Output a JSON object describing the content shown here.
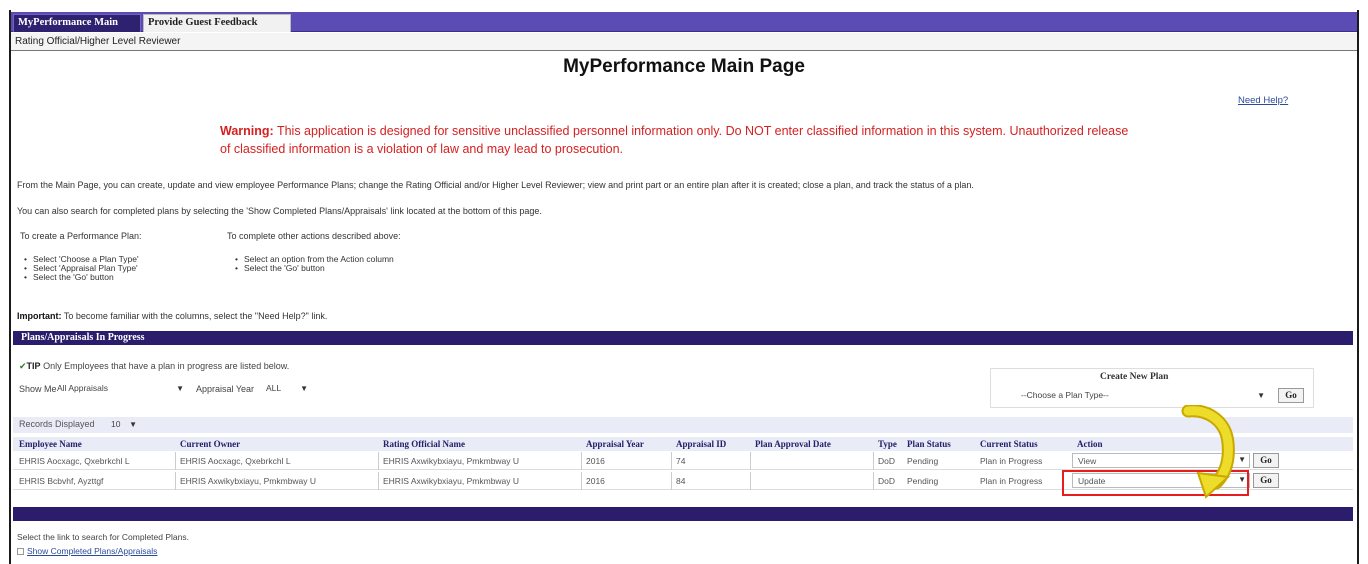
{
  "tabs": {
    "main": "MyPerformance Main Page",
    "feedback": "Provide Guest Feedback"
  },
  "role": "Rating Official/Higher Level Reviewer",
  "page_title": "MyPerformance Main Page",
  "help_link": "Need Help?",
  "warning": {
    "label": "Warning:",
    "text": "This application is designed for sensitive unclassified personnel information only. Do NOT enter classified information in this system. Unauthorized release of classified information is a violation of law and may lead to prosecution."
  },
  "intro": {
    "line1": "From the Main Page, you can create, update and view employee Performance Plans; change the Rating Official and/or Higher Level Reviewer; view and print part or an entire plan after it is created; close a plan, and track the status of a plan.",
    "line2": "You can also search for completed plans by selecting the 'Show Completed Plans/Appraisals' link located at the bottom of this page."
  },
  "create_instructions": {
    "heading": "To create a Performance Plan:",
    "steps": [
      "Select 'Choose a Plan Type'",
      "Select 'Appraisal Plan Type'",
      "Select the 'Go' button"
    ]
  },
  "other_instructions": {
    "heading": "To complete other actions described above:",
    "steps": [
      "Select an option from the Action column",
      "Select the 'Go' button"
    ]
  },
  "important": {
    "label": "Important:",
    "text": "To become familiar with the columns, select the \"Need Help?\" link."
  },
  "section_title": "Plans/Appraisals In Progress",
  "tip": {
    "label": "TIP",
    "text": "Only Employees that have a plan in progress are listed below."
  },
  "filters": {
    "show_me_label": "Show Me",
    "show_me_value": "All Appraisals",
    "year_label": "Appraisal Year",
    "year_value": "ALL"
  },
  "create_plan": {
    "title": "Create New Plan",
    "placeholder": "--Choose a Plan Type--",
    "go": "Go"
  },
  "records": {
    "label": "Records Displayed",
    "value": "10"
  },
  "table": {
    "headers": [
      "Employee Name",
      "Current Owner",
      "Rating Official Name",
      "Appraisal Year",
      "Appraisal ID",
      "Plan Approval Date",
      "Type",
      "Plan Status",
      "Current Status",
      "Action"
    ],
    "rows": [
      {
        "employee": "EHRIS Aocxagc, Qxebrkchl L",
        "owner": "EHRIS Aocxagc, Qxebrkchl L",
        "rating_official": "EHRIS Axwikybxiayu, Pmkmbway U",
        "year": "2016",
        "id": "74",
        "approval_date": "",
        "type": "DoD",
        "plan_status": "Pending",
        "current_status": "Plan in Progress",
        "action": "View",
        "go": "Go"
      },
      {
        "employee": "EHRIS Bcbvhf, Ayzttgf",
        "owner": "EHRIS Axwikybxiayu, Pmkmbway U",
        "rating_official": "EHRIS Axwikybxiayu, Pmkmbway U",
        "year": "2016",
        "id": "84",
        "approval_date": "",
        "type": "DoD",
        "plan_status": "Pending",
        "current_status": "Plan in Progress",
        "action": "Update",
        "go": "Go"
      }
    ]
  },
  "footer": {
    "text": "Select the link to search for Completed Plans.",
    "link": "Show Completed Plans/Appraisals"
  },
  "colors": {
    "tab_bar": "#5b4bb5",
    "section_bar": "#2b1d6b",
    "warning": "#d62020",
    "highlight": "#e81c1c",
    "arrow": "#e6d21a"
  }
}
